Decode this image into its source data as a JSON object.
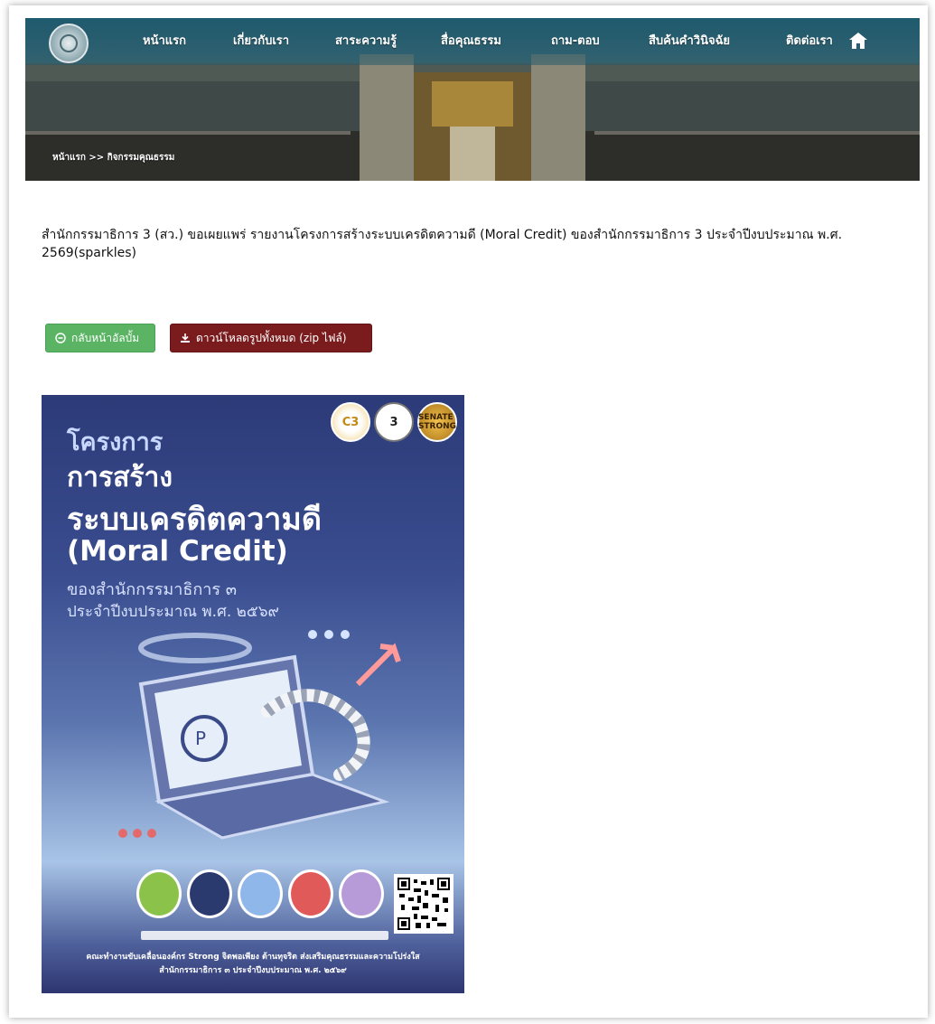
{
  "header": {
    "nav": [
      {
        "label": "หน้าแรก"
      },
      {
        "label": "เกี่ยวกับเรา"
      },
      {
        "label": "สาระความรู้"
      },
      {
        "label": "สื่อคุณธรรม"
      },
      {
        "label": "ถาม-ตอบ"
      },
      {
        "label": "สืบค้นคำวินิจฉัย"
      },
      {
        "label": "ติดต่อเรา"
      }
    ],
    "breadcrumb": "หน้าแรก >> กิจกรรมคุณธรรม"
  },
  "headline": "สำนักกรรมาธิการ 3 (สว.) ขอเผยแพร่ รายงานโครงการสร้างระบบเครดิตความดี (Moral Credit) ของสำนักกรรมาธิการ 3 ประจำปีงบประมาณ พ.ศ. 2569(sparkles)",
  "buttons": {
    "back_label": "กลับหน้าอัลบั้ม",
    "download_label": "ดาวน์โหลดรูปทั้งหมด (zip ไฟล์)"
  },
  "poster": {
    "line1": "โครงการ",
    "line2": "การสร้าง",
    "line3": "ระบบเครดิตความดี",
    "line4": "(Moral Credit)",
    "line5": "ของสำนักกรรมาธิการ ๓",
    "line6": "ประจำปีงบประมาณ พ.ศ. ๒๕๖๙",
    "badge1": "C3",
    "badge2": "3",
    "badge3": "SENATE STRONG",
    "footer_line1": "คณะทำงานขับเคลื่อนองค์กร Strong จิตพอเพียง ต้านทุจริต ส่งเสริมคุณธรรมและความโปร่งใส",
    "footer_line2": "สำนักกรรมาธิการ ๓ ประจำปีงบประมาณ พ.ศ. ๒๕๖๙"
  }
}
